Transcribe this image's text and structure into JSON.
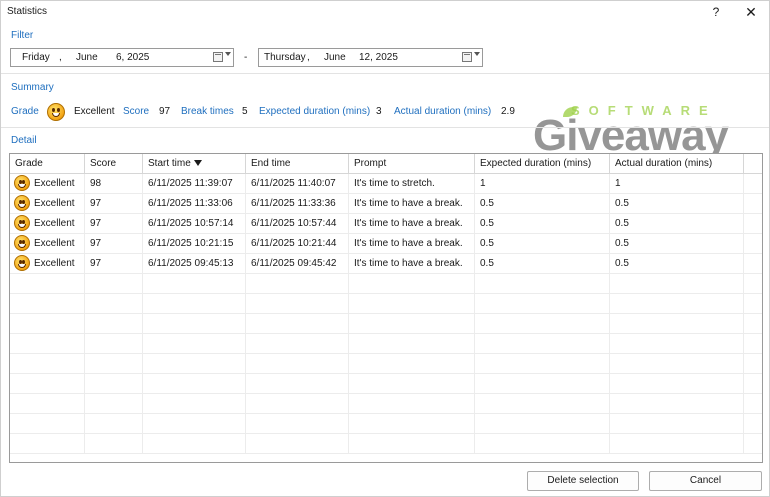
{
  "window": {
    "title": "Statistics",
    "help": "?",
    "close": "✕"
  },
  "filter": {
    "label": "Filter",
    "from": {
      "weekday": "Friday",
      "month": "June",
      "day_year": "6, 2025"
    },
    "separator": "-",
    "to": {
      "weekday": "Thursday",
      "month": "June",
      "day_year": "12, 2025"
    }
  },
  "summary": {
    "label": "Summary",
    "grade_label": "Grade",
    "grade_value": "Excellent",
    "score_label": "Score",
    "score_value": "97",
    "break_label": "Break times",
    "break_value": "5",
    "expected_label": "Expected duration (mins)",
    "expected_value": "3",
    "actual_label": "Actual duration (mins)",
    "actual_value": "2.9"
  },
  "watermark": {
    "top": "SOFTWARE",
    "main": "Giveaway"
  },
  "detail": {
    "label": "Detail",
    "columns": [
      "Grade",
      "Score",
      "Start time",
      "End time",
      "Prompt",
      "Expected duration (mins)",
      "Actual duration (mins)"
    ],
    "rows": [
      {
        "grade": "Excellent",
        "score": "98",
        "start": "6/11/2025 11:39:07",
        "end": "6/11/2025 11:40:07",
        "prompt": "It's time to stretch.",
        "expected": "1",
        "actual": "1"
      },
      {
        "grade": "Excellent",
        "score": "97",
        "start": "6/11/2025 11:33:06",
        "end": "6/11/2025 11:33:36",
        "prompt": "It's time to have a break.",
        "expected": "0.5",
        "actual": "0.5"
      },
      {
        "grade": "Excellent",
        "score": "97",
        "start": "6/11/2025 10:57:14",
        "end": "6/11/2025 10:57:44",
        "prompt": "It's time to have a break.",
        "expected": "0.5",
        "actual": "0.5"
      },
      {
        "grade": "Excellent",
        "score": "97",
        "start": "6/11/2025 10:21:15",
        "end": "6/11/2025 10:21:44",
        "prompt": "It's time to have a break.",
        "expected": "0.5",
        "actual": "0.5"
      },
      {
        "grade": "Excellent",
        "score": "97",
        "start": "6/11/2025 09:45:13",
        "end": "6/11/2025 09:45:42",
        "prompt": "It's time to have a break.",
        "expected": "0.5",
        "actual": "0.5"
      }
    ]
  },
  "buttons": {
    "delete": "Delete selection",
    "cancel": "Cancel"
  }
}
